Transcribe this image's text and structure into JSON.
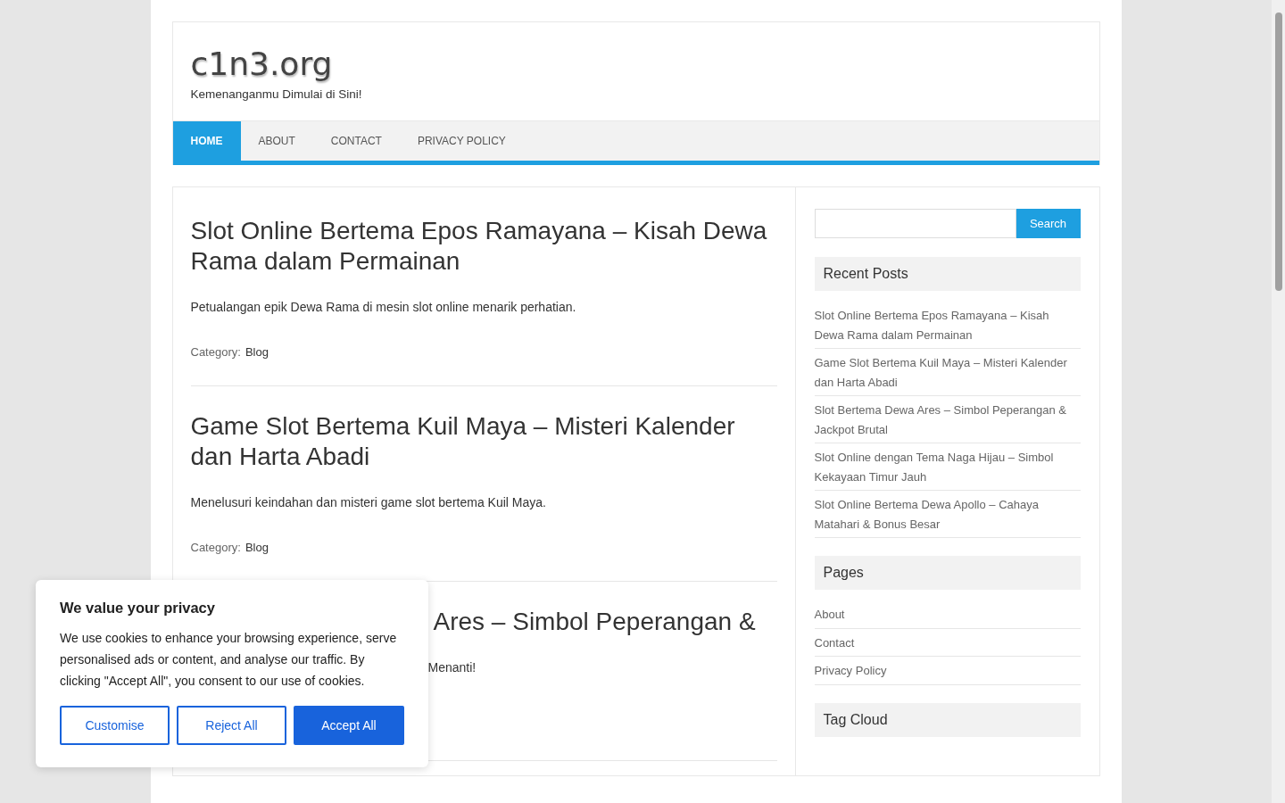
{
  "site": {
    "title": "c1n3.org",
    "tagline": "Kemenanganmu Dimulai di Sini!"
  },
  "nav": [
    {
      "label": "HOME",
      "selected": true
    },
    {
      "label": "ABOUT",
      "selected": false
    },
    {
      "label": "CONTACT",
      "selected": false
    },
    {
      "label": "PRIVACY POLICY",
      "selected": false
    }
  ],
  "posts": [
    {
      "kind": "full",
      "title": "Slot Online Bertema Epos Ramayana – Kisah Dewa Rama dalam Permainan",
      "excerpt": "Petualangan epik Dewa Rama di mesin slot online menarik perhatian.",
      "category_label": "Category:",
      "category": "Blog"
    },
    {
      "kind": "full",
      "title": "Game Slot Bertema Kuil Maya – Misteri Kalender dan Harta Abadi",
      "excerpt": "Menelusuri keindahan dan misteri game slot bertema Kuil Maya.",
      "category_label": "Category:",
      "category": "Blog"
    },
    {
      "kind": "covered",
      "title": "Ares – Simbol Peperangan &",
      "excerpt": "Menanti!"
    }
  ],
  "sidebar": {
    "search_button": "Search",
    "recent_posts": {
      "heading": "Recent Posts",
      "items": [
        "Slot Online Bertema Epos Ramayana – Kisah Dewa Rama dalam Permainan",
        "Game Slot Bertema Kuil Maya – Misteri Kalender dan Harta Abadi",
        "Slot Bertema Dewa Ares – Simbol Peperangan & Jackpot Brutal",
        "Slot Online dengan Tema Naga Hijau – Simbol Kekayaan Timur Jauh",
        "Slot Online Bertema Dewa Apollo – Cahaya Matahari & Bonus Besar"
      ]
    },
    "pages": {
      "heading": "Pages",
      "items": [
        "About",
        "Contact",
        "Privacy Policy"
      ]
    },
    "tag_cloud": {
      "heading": "Tag Cloud"
    }
  },
  "cookie_banner": {
    "title": "We value your privacy",
    "text": "We use cookies to enhance your browsing experience, serve personalised ads or content, and analyse our traffic. By clicking \"Accept All\", you consent to our use of cookies.",
    "buttons": [
      {
        "label": "Customise",
        "kind": "outline"
      },
      {
        "label": "Reject All",
        "kind": "outline"
      },
      {
        "label": "Accept All",
        "kind": "primary"
      }
    ]
  }
}
